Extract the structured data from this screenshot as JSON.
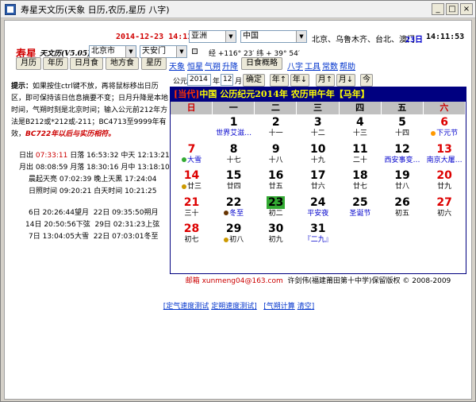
{
  "window": {
    "title": "寿星天文历(天象 日历,农历,星历 八字)",
    "min": "_",
    "max": "□",
    "close": "×"
  },
  "top": {
    "datetime": "2014-12-23 14:11:53",
    "region": "亚洲",
    "country": "中国",
    "cities": "北京、乌鲁木齐、台北、澳门",
    "date_day": "23日",
    "time": "14:11:53"
  },
  "brand": {
    "name": "寿星",
    "sub": "天文历(V5.05)"
  },
  "location": {
    "city": "北京市",
    "place": "天安门",
    "coords": "经 +116° 23′ 纬 + 39° 54′"
  },
  "nav_buttons": [
    "月历",
    "年历",
    "日月食",
    "地方食",
    "星历"
  ],
  "nav_links": [
    "天象",
    "恒星",
    "气朔",
    "升降"
  ],
  "eclipse_btn": "日食概略",
  "extra_links": [
    "八字",
    "工具",
    "常数",
    "帮助"
  ],
  "tips": {
    "title": "提示：",
    "body": "如果按住ctrl键不放，再将鼠标移出日历区，即可保持该日信息摘要不变；日月升降是本地时间，气朔时刻是北京时间；输入公元前212年方法是B212或*212或-211；BC4713至9999年有效，",
    "warn": "BC722年以后与实历相符。"
  },
  "sun_moon": [
    {
      "a": "日出",
      "av": "07:33:11",
      "b": "日落",
      "bv": "16:53:32",
      "c": "中天",
      "cv": "12:13:21"
    },
    {
      "a": "月出",
      "av": "08:08:59",
      "b": "月落",
      "bv": "18:30:16",
      "c": "月中",
      "cv": "13:18:10"
    },
    {
      "a": "晨起天亮",
      "av": "07:02:39",
      "b": "晚上天黑",
      "bv": "17:24:04",
      "c": "",
      "cv": ""
    },
    {
      "a": "日照时间",
      "av": "09:20:21",
      "b": "白天时间",
      "bv": "10:21:25",
      "c": "",
      "cv": ""
    }
  ],
  "phases": [
    {
      "l": "6日 20:26:44望月",
      "r": "22日 09:35:50朔月"
    },
    {
      "l": "14日 20:50:56下弦",
      "r": "29日 02:31:23上弦"
    },
    {
      "l": "7日 13:04:05大雪",
      "r": "22日 07:03:01冬至"
    }
  ],
  "controls": {
    "gong_label": "公元",
    "year": "2014",
    "year_unit": "年",
    "month": "12",
    "month_unit": "月",
    "ok": "确定",
    "prev_year": "年↑",
    "next_year": "年↓",
    "prev_month": "月↑",
    "next_month": "月↓",
    "today": "今"
  },
  "calendar": {
    "header_cur": "[当代]",
    "header": "中国 公历纪元2014年 农历甲午年【马年】",
    "weekdays": [
      "日",
      "一",
      "二",
      "三",
      "四",
      "五",
      "六"
    ]
  },
  "days": [
    {
      "n": "1",
      "s": "世界艾滋…",
      "sc": "blue",
      "red": false
    },
    {
      "n": "2",
      "s": "十一",
      "sc": "",
      "red": false
    },
    {
      "n": "3",
      "s": "十二",
      "sc": "",
      "red": false
    },
    {
      "n": "4",
      "s": "十三",
      "sc": "",
      "red": false
    },
    {
      "n": "5",
      "s": "十四",
      "sc": "",
      "red": false
    },
    {
      "n": "6",
      "s": "下元节",
      "sc": "blue",
      "red": true,
      "dot": "#ff9900"
    },
    {
      "n": "7",
      "s": "大雪",
      "sc": "blue",
      "red": true,
      "dot": "#33aa33"
    },
    {
      "n": "8",
      "s": "十七",
      "sc": "",
      "red": false
    },
    {
      "n": "9",
      "s": "十八",
      "sc": "",
      "red": false
    },
    {
      "n": "10",
      "s": "十九",
      "sc": "",
      "red": false
    },
    {
      "n": "11",
      "s": "二十",
      "sc": "",
      "red": false
    },
    {
      "n": "12",
      "s": "西安事变…",
      "sc": "blue",
      "red": false
    },
    {
      "n": "13",
      "s": "南京大屠…",
      "sc": "blue",
      "red": true
    },
    {
      "n": "14",
      "s": "廿三",
      "sc": "",
      "red": true,
      "dot": "#cc9900"
    },
    {
      "n": "15",
      "s": "廿四",
      "sc": "",
      "red": false
    },
    {
      "n": "16",
      "s": "廿五",
      "sc": "",
      "red": false
    },
    {
      "n": "17",
      "s": "廿六",
      "sc": "",
      "red": false
    },
    {
      "n": "18",
      "s": "廿七",
      "sc": "",
      "red": false
    },
    {
      "n": "19",
      "s": "廿八",
      "sc": "",
      "red": false
    },
    {
      "n": "20",
      "s": "廿九",
      "sc": "",
      "red": true
    },
    {
      "n": "21",
      "s": "三十",
      "sc": "",
      "red": true
    },
    {
      "n": "22",
      "s": "冬至",
      "sc": "blue",
      "red": false,
      "dot": "#663300"
    },
    {
      "n": "23",
      "s": "初二",
      "sc": "",
      "red": false,
      "today": true
    },
    {
      "n": "24",
      "s": "平安夜",
      "sc": "blue",
      "red": false
    },
    {
      "n": "25",
      "s": "圣诞节",
      "sc": "blue",
      "red": false
    },
    {
      "n": "26",
      "s": "初五",
      "sc": "",
      "red": false
    },
    {
      "n": "27",
      "s": "初六",
      "sc": "",
      "red": true
    },
    {
      "n": "28",
      "s": "初七",
      "sc": "",
      "red": true
    },
    {
      "n": "29",
      "s": "初八",
      "sc": "",
      "red": false,
      "dot": "#cc9900"
    },
    {
      "n": "30",
      "s": "初九",
      "sc": "",
      "red": false
    },
    {
      "n": "31",
      "s": "『二九』",
      "sc": "blue",
      "red": false
    }
  ],
  "footer": {
    "left": "邮箱 xunmeng04@163.com",
    "right": "许剑伟(福建莆田第十中学)保留版权 © 2008-2009"
  },
  "bottom_links": [
    "[定气速度测试",
    "定朔速度测试]",
    "[气朔计算",
    "清空]"
  ]
}
